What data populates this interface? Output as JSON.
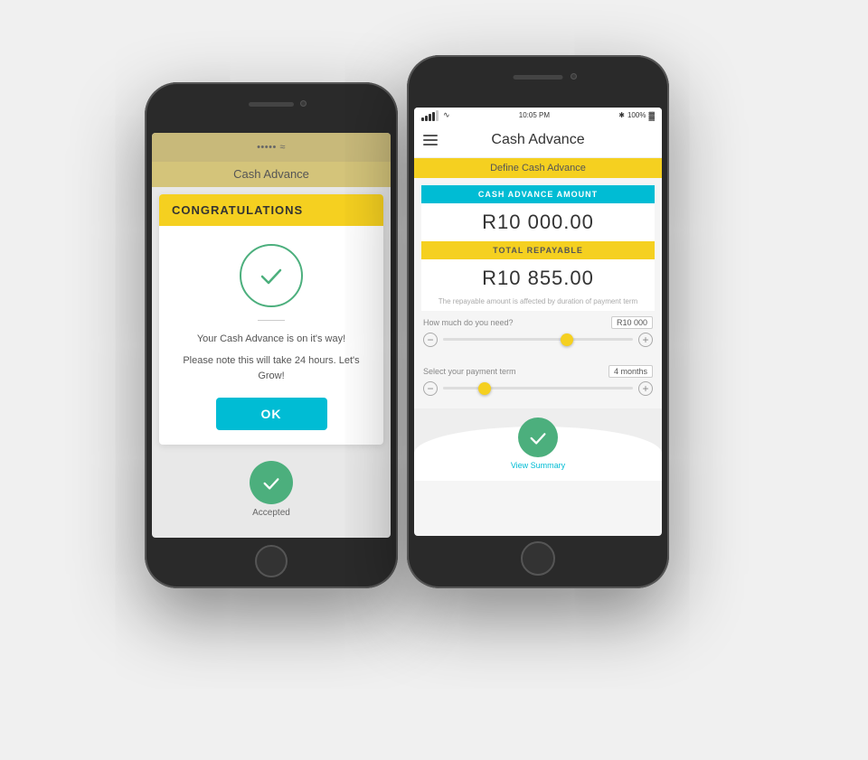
{
  "back_phone": {
    "app_title": "Cash Advance",
    "congratulations": "CONGRATULATIONS",
    "message_line1": "Your Cash Advance is on it's way!",
    "message_line2": "Please note this will take 24 hours. Let's Grow!",
    "ok_button": "OK",
    "accepted_label": "Accepted"
  },
  "front_phone": {
    "status": {
      "time": "10:05 PM",
      "battery": "100%",
      "bluetooth": "✱"
    },
    "app_title": "Cash Advance",
    "define_bar": "Define Cash Advance",
    "cash_advance_label": "CASH ADVANCE AMOUNT",
    "cash_advance_value": "R10 000.00",
    "total_repayable_label": "TOTAL REPAYABLE",
    "total_repayable_value": "R10 855.00",
    "repayable_note": "The repayable amount is affected by duration of payment term",
    "slider1": {
      "label": "How much do you need?",
      "value": "R10 000",
      "thumb_position": "65"
    },
    "slider2": {
      "label": "Select your payment term",
      "value": "4 months",
      "thumb_position": "22"
    },
    "view_summary": "View Summary"
  }
}
